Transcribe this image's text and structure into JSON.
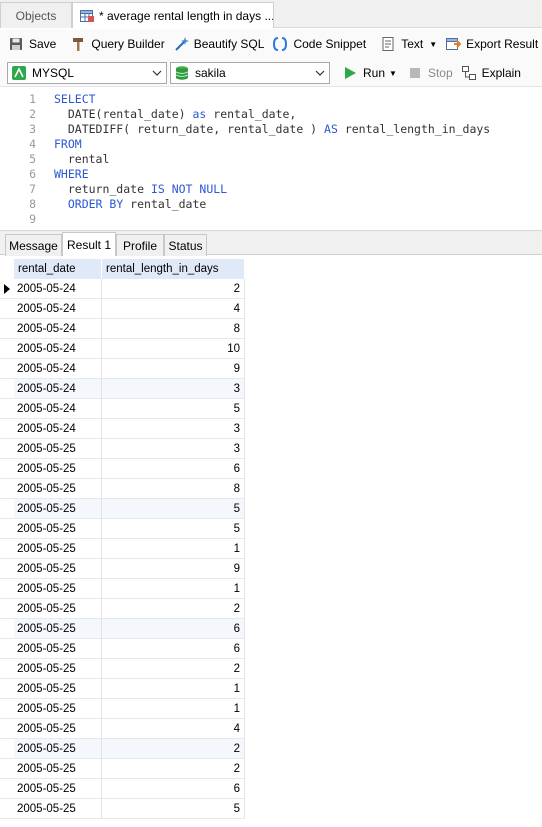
{
  "tabs": {
    "objects_label": "Objects",
    "query_label": "* average rental length in days ..."
  },
  "toolbar": {
    "save_label": "Save",
    "query_builder_label": "Query Builder",
    "beautify_label": "Beautify SQL",
    "code_snippet_label": "Code Snippet",
    "text_label": "Text",
    "export_label": "Export Result"
  },
  "connection_bar": {
    "connection": "MYSQL",
    "database": "sakila",
    "run_label": "Run",
    "stop_label": "Stop",
    "explain_label": "Explain"
  },
  "editor": {
    "lines": [
      {
        "num": "1",
        "parts": [
          {
            "t": "SELECT",
            "k": true
          }
        ]
      },
      {
        "num": "2",
        "parts": [
          {
            "t": "  DATE(rental_date) ",
            "k": false
          },
          {
            "t": "as",
            "k": true
          },
          {
            "t": " rental_date,",
            "k": false
          }
        ]
      },
      {
        "num": "3",
        "parts": [
          {
            "t": "  DATEDIFF( return_date, rental_date ) ",
            "k": false
          },
          {
            "t": "AS",
            "k": true
          },
          {
            "t": " rental_length_in_days",
            "k": false
          }
        ]
      },
      {
        "num": "4",
        "parts": [
          {
            "t": "FROM",
            "k": true
          }
        ]
      },
      {
        "num": "5",
        "parts": [
          {
            "t": "  rental",
            "k": false
          }
        ]
      },
      {
        "num": "6",
        "parts": [
          {
            "t": "WHERE",
            "k": true
          }
        ]
      },
      {
        "num": "7",
        "parts": [
          {
            "t": "  return_date ",
            "k": false
          },
          {
            "t": "IS NOT NULL",
            "k": true
          }
        ]
      },
      {
        "num": "8",
        "parts": [
          {
            "t": "  ",
            "k": false
          },
          {
            "t": "ORDER BY",
            "k": true
          },
          {
            "t": " rental_date",
            "k": false
          }
        ]
      },
      {
        "num": "9",
        "parts": []
      }
    ]
  },
  "result_tabs": [
    "Message",
    "Result 1",
    "Profile",
    "Status"
  ],
  "result_active_tab": "Result 1",
  "grid": {
    "columns": [
      "rental_date",
      "rental_length_in_days"
    ],
    "rows": [
      [
        "2005-05-24",
        "2"
      ],
      [
        "2005-05-24",
        "4"
      ],
      [
        "2005-05-24",
        "8"
      ],
      [
        "2005-05-24",
        "10"
      ],
      [
        "2005-05-24",
        "9"
      ],
      [
        "2005-05-24",
        "3"
      ],
      [
        "2005-05-24",
        "5"
      ],
      [
        "2005-05-24",
        "3"
      ],
      [
        "2005-05-25",
        "3"
      ],
      [
        "2005-05-25",
        "6"
      ],
      [
        "2005-05-25",
        "8"
      ],
      [
        "2005-05-25",
        "5"
      ],
      [
        "2005-05-25",
        "5"
      ],
      [
        "2005-05-25",
        "1"
      ],
      [
        "2005-05-25",
        "9"
      ],
      [
        "2005-05-25",
        "1"
      ],
      [
        "2005-05-25",
        "2"
      ],
      [
        "2005-05-25",
        "6"
      ],
      [
        "2005-05-25",
        "6"
      ],
      [
        "2005-05-25",
        "2"
      ],
      [
        "2005-05-25",
        "1"
      ],
      [
        "2005-05-25",
        "1"
      ],
      [
        "2005-05-25",
        "4"
      ],
      [
        "2005-05-25",
        "2"
      ],
      [
        "2005-05-25",
        "2"
      ],
      [
        "2005-05-25",
        "6"
      ],
      [
        "2005-05-25",
        "5"
      ]
    ],
    "selected_row": 0
  },
  "colors": {
    "keyword": "#2a58d6",
    "header_bg": "#dfe9f7",
    "alt_row_bg": "#f4f8fd",
    "run_green": "#2ea84a"
  }
}
